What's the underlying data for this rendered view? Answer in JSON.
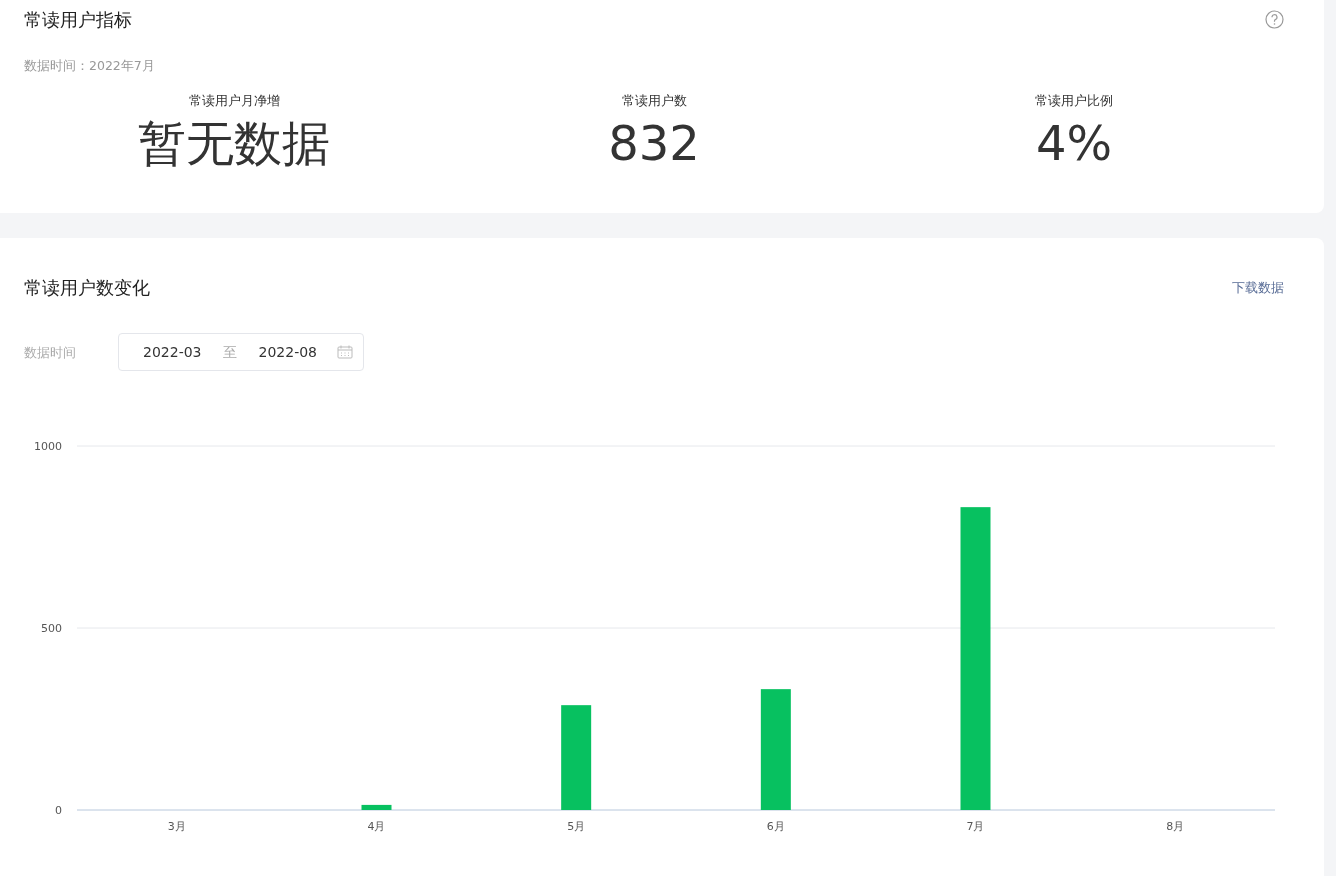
{
  "indicators": {
    "title": "常读用户指标",
    "data_time": "数据时间：2022年7月",
    "metrics": [
      {
        "label": "常读用户月净增",
        "value": "暂无数据"
      },
      {
        "label": "常读用户数",
        "value": "832"
      },
      {
        "label": "常读用户比例",
        "value": "4%"
      }
    ]
  },
  "trend": {
    "title": "常读用户数变化",
    "download": "下载数据",
    "filter_label": "数据时间",
    "date_range": {
      "start": "2022-03",
      "separator": "至",
      "end": "2022-08"
    },
    "chart_data": {
      "type": "bar",
      "categories": [
        "3月",
        "4月",
        "5月",
        "6月",
        "7月",
        "8月"
      ],
      "series": [
        {
          "color": "#07c160",
          "values": [
            0,
            14,
            288,
            332,
            832,
            0
          ]
        }
      ],
      "ylim": [
        0,
        1000
      ],
      "yticks": [
        0,
        500,
        1000
      ]
    }
  }
}
